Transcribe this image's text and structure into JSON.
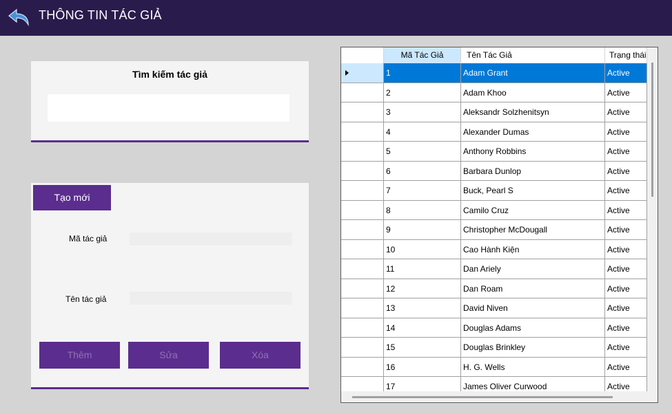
{
  "header": {
    "title": "THÔNG TIN TÁC GIẢ",
    "back_icon": "back-arrow-icon"
  },
  "search": {
    "title": "Tìm kiếm tác giả",
    "value": "",
    "placeholder": ""
  },
  "form": {
    "tab_label": "Tạo mới",
    "id_label": "Mã tác giả",
    "name_label": "Tên tác giả",
    "id_value": "",
    "name_value": "",
    "buttons": {
      "add": "Thêm",
      "edit": "Sửa",
      "delete": "Xóa"
    }
  },
  "grid": {
    "columns": [
      "Mã Tác Giả",
      "Tên Tác Giả",
      "Trạng thái"
    ],
    "selected_index": 0,
    "rows": [
      [
        "1",
        "Adam Grant",
        "Active"
      ],
      [
        "2",
        "Adam Khoo",
        "Active"
      ],
      [
        "3",
        "Aleksandr Solzhenitsyn",
        "Active"
      ],
      [
        "4",
        "Alexander Dumas",
        "Active"
      ],
      [
        "5",
        "Anthony Robbins",
        "Active"
      ],
      [
        "6",
        "Barbara Dunlop",
        "Active"
      ],
      [
        "7",
        "Buck, Pearl S",
        "Active"
      ],
      [
        "8",
        "Camilo Cruz",
        "Active"
      ],
      [
        "9",
        "Christopher McDougall",
        "Active"
      ],
      [
        "10",
        "Cao Hành Kiện",
        "Active"
      ],
      [
        "11",
        "Dan Ariely",
        "Active"
      ],
      [
        "12",
        "Dan Roam",
        "Active"
      ],
      [
        "13",
        "David Niven",
        "Active"
      ],
      [
        "14",
        "Douglas Adams",
        "Active"
      ],
      [
        "15",
        "Douglas Brinkley",
        "Active"
      ],
      [
        "16",
        "H. G. Wells",
        "Active"
      ],
      [
        "17",
        "James Oliver Curwood",
        "Active"
      ]
    ]
  },
  "colors": {
    "header_bg": "#2a1b4d",
    "accent": "#5b2d8e",
    "selection": "#0078d7"
  }
}
